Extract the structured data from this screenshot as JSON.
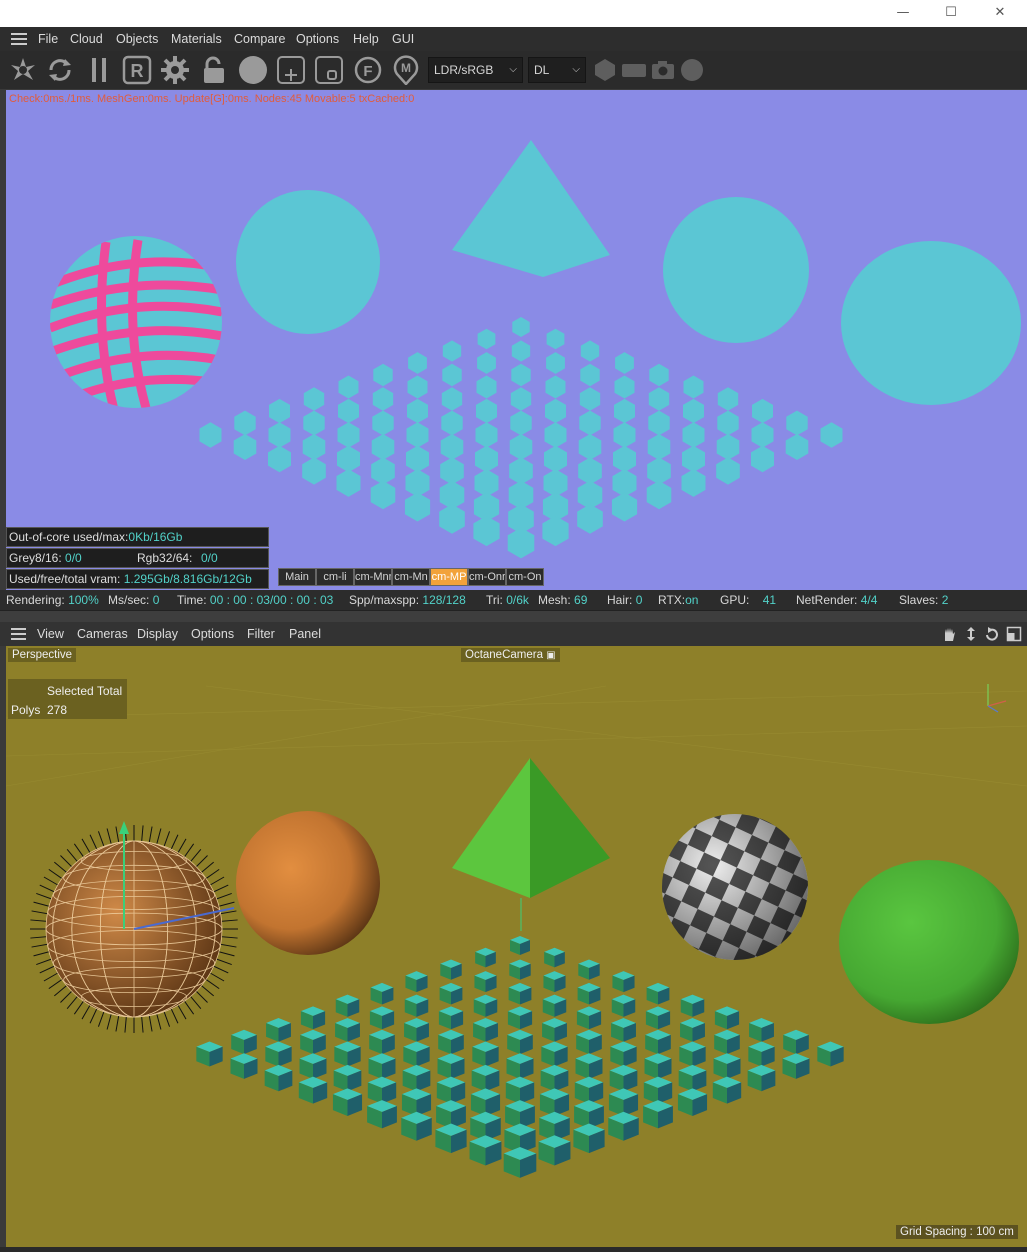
{
  "window_controls": {
    "minimize": "—",
    "maximize": "☐",
    "close": "✕"
  },
  "menubar": {
    "items": [
      "File",
      "Cloud",
      "Objects",
      "Materials",
      "Compare",
      "Options",
      "Help",
      "GUI"
    ]
  },
  "toolbar": {
    "icons": [
      "octane-logo-icon",
      "refresh-icon",
      "pause-icon",
      "r-icon",
      "gear-icon",
      "lock-icon",
      "sphere-icon",
      "add-region-icon",
      "region-icon",
      "f-icon",
      "m-pin-icon"
    ],
    "r_label": "R",
    "f_label": "F",
    "m_label": "M",
    "tonemap_select": "LDR/sRGB",
    "kernel_select": "DL",
    "right_icons": [
      "hexagon-icon",
      "rectangle-icon",
      "camera-icon",
      "circle-icon"
    ]
  },
  "render": {
    "stats_line": "Check:0ms./1ms. MeshGen:0ms. Update[G]:0ms. Nodes:45 Movable:5 txCached:0",
    "colors": {
      "background": "#8a8be6",
      "cyan": "#5bc6d4",
      "pink": "#ee4a9c"
    },
    "info": {
      "out_of_core_label": "Out-of-core used/max:",
      "out_of_core_value": "0Kb/16Gb",
      "grey_label": "Grey8/16:",
      "grey_value": "0/0",
      "rgb_label": "Rgb32/64:",
      "rgb_value": "0/0",
      "vram_label": "Used/free/total vram:",
      "vram_value": "1.295Gb/8.816Gb/12Gb"
    },
    "tabs": [
      {
        "label": "Main",
        "active": false
      },
      {
        "label": "cm-li",
        "active": false
      },
      {
        "label": "cm-Mnr",
        "active": false
      },
      {
        "label": "cm-Mn",
        "active": false
      },
      {
        "label": "cm-MP",
        "active": true
      },
      {
        "label": "cm-Onr",
        "active": false
      },
      {
        "label": "cm-On",
        "active": false
      }
    ]
  },
  "status": {
    "rendering_label": "Rendering:",
    "rendering_value": "100%",
    "ms_label": "Ms/sec:",
    "ms_value": "0",
    "time_label": "Time:",
    "time_value": "00 : 00 : 03/00 : 00 : 03",
    "spp_label": "Spp/maxspp:",
    "spp_value": "128/128",
    "tri_label": "Tri:",
    "tri_value": "0/6k",
    "mesh_label": "Mesh:",
    "mesh_value": "69",
    "hair_label": "Hair:",
    "hair_value": "0",
    "rtx_label": "RTX:",
    "rtx_value": "on",
    "gpu_label": "GPU:",
    "gpu_value": "41",
    "netrender_label": "NetRender:",
    "netrender_value": "4/4",
    "slaves_label": "Slaves:",
    "slaves_value": "2"
  },
  "viewport": {
    "menu": [
      "View",
      "Cameras",
      "Display",
      "Options",
      "Filter",
      "Panel"
    ],
    "nav_icons": [
      "hand-icon",
      "move-icon",
      "rotate-icon",
      "maximize-icon"
    ],
    "perspective_label": "Perspective",
    "camera_label": "OctaneCamera",
    "selected_total": "Selected Total",
    "polys_label": "Polys",
    "polys_value": "278",
    "grid_spacing": "Grid Spacing : 100 cm",
    "colors": {
      "background": "#8e8029",
      "orange": "#d3843a",
      "green": "#4db83a"
    }
  }
}
